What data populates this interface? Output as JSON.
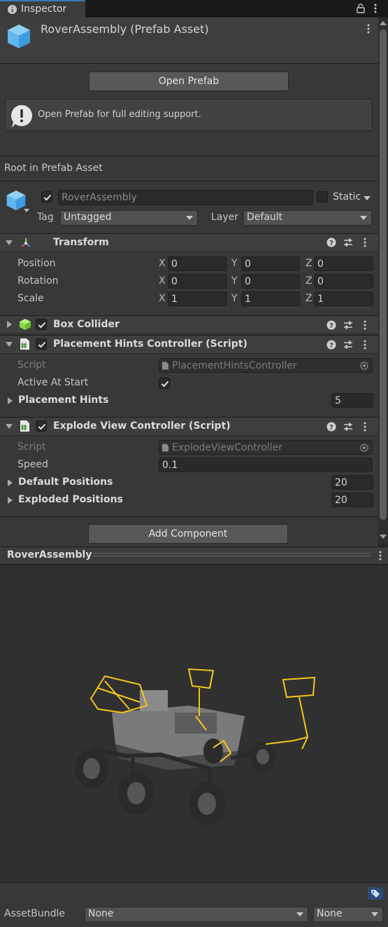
{
  "tab": {
    "label": "Inspector"
  },
  "header": {
    "title": "RoverAssembly (Prefab Asset)"
  },
  "prefab": {
    "open_button": "Open Prefab",
    "help_text": "Open Prefab for full editing support.",
    "root_label": "Root in Prefab Asset"
  },
  "gameobject": {
    "name": "RoverAssembly",
    "static_label": "Static",
    "tag_label": "Tag",
    "tag_value": "Untagged",
    "layer_label": "Layer",
    "layer_value": "Default"
  },
  "transform": {
    "title": "Transform",
    "rows": [
      {
        "label": "Position",
        "x": "0",
        "y": "0",
        "z": "0"
      },
      {
        "label": "Rotation",
        "x": "0",
        "y": "0",
        "z": "0"
      },
      {
        "label": "Scale",
        "x": "1",
        "y": "1",
        "z": "1"
      }
    ],
    "axes": {
      "x": "X",
      "y": "Y",
      "z": "Z"
    }
  },
  "box_collider": {
    "title": "Box Collider"
  },
  "placement": {
    "title": "Placement Hints Controller (Script)",
    "script_label": "Script",
    "script_value": "PlacementHintsController",
    "active_label": "Active At Start",
    "hints_label": "Placement Hints",
    "hints_value": "5"
  },
  "explode": {
    "title": "Explode View Controller (Script)",
    "script_label": "Script",
    "script_value": "ExplodeViewController",
    "speed_label": "Speed",
    "speed_value": "0.1",
    "default_label": "Default Positions",
    "default_value": "20",
    "exploded_label": "Exploded Positions",
    "exploded_value": "20"
  },
  "add_component": "Add Component",
  "preview": {
    "title": "RoverAssembly"
  },
  "footer": {
    "assetbundle_label": "AssetBundle",
    "bundle_value": "None",
    "variant_value": "None"
  },
  "colors": {
    "accent": "#3a79bb",
    "prefab_blue": "#5fb7f0",
    "highlight": "#f5c518"
  }
}
